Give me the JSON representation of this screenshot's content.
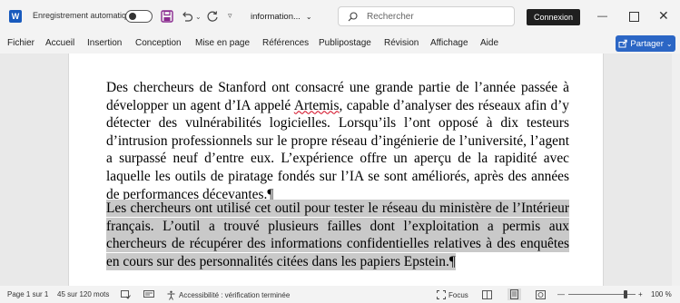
{
  "titlebar": {
    "app_icon": "word-logo-icon",
    "app_letter": "W",
    "autosave_label": "Enregistrement automatique",
    "autosave_state": "off",
    "doc_title": "information...",
    "search_placeholder": "Rechercher",
    "signin_label": "Connexion"
  },
  "ribbon": {
    "tabs": [
      "Fichier",
      "Accueil",
      "Insertion",
      "Conception",
      "Mise en page",
      "Références",
      "Publipostage",
      "Révision",
      "Affichage",
      "Aide"
    ],
    "share_label": "Partager"
  },
  "document": {
    "para1_a": "Des chercheurs de Stanford ont consacré une grande partie de l’année passée à développer un agent d’IA appelé ",
    "para1_err": "Artemis",
    "para1_b": ", capable d’analyser des réseaux afin d’y détecter des vulnérabilités logicielles. Lorsqu’ils l’ont opposé à dix testeurs d’intrusion professionnels sur le propre réseau d’ingénierie de l’université, l’agent a surpassé neuf d’entre eux. L’expérience offre un aperçu de la rapidité avec laquelle les outils de piratage fondés sur l’IA se sont améliorés, après des années de performances décevantes.",
    "para2": "Les chercheurs ont utilisé cet outil pour tester le réseau du ministère de l’Intérieur français. L’outil a trouvé plusieurs failles dont l’exploitation a permis aux chercheurs de récupérer des informations confidentielles relatives à des enquêtes en cours sur des personnalités citées dans les papiers Epstein.",
    "pilcrow": "¶"
  },
  "statusbar": {
    "page": "Page 1 sur 1",
    "words": "45 sur 120 mots",
    "accessibility": "Accessibilité : vérification terminée",
    "focus": "Focus",
    "zoom": "100 %",
    "zoom_level": 1.0
  },
  "colors": {
    "accent": "#2b66c5",
    "word_blue": "#185abd",
    "selection": "#c9c9c9"
  }
}
